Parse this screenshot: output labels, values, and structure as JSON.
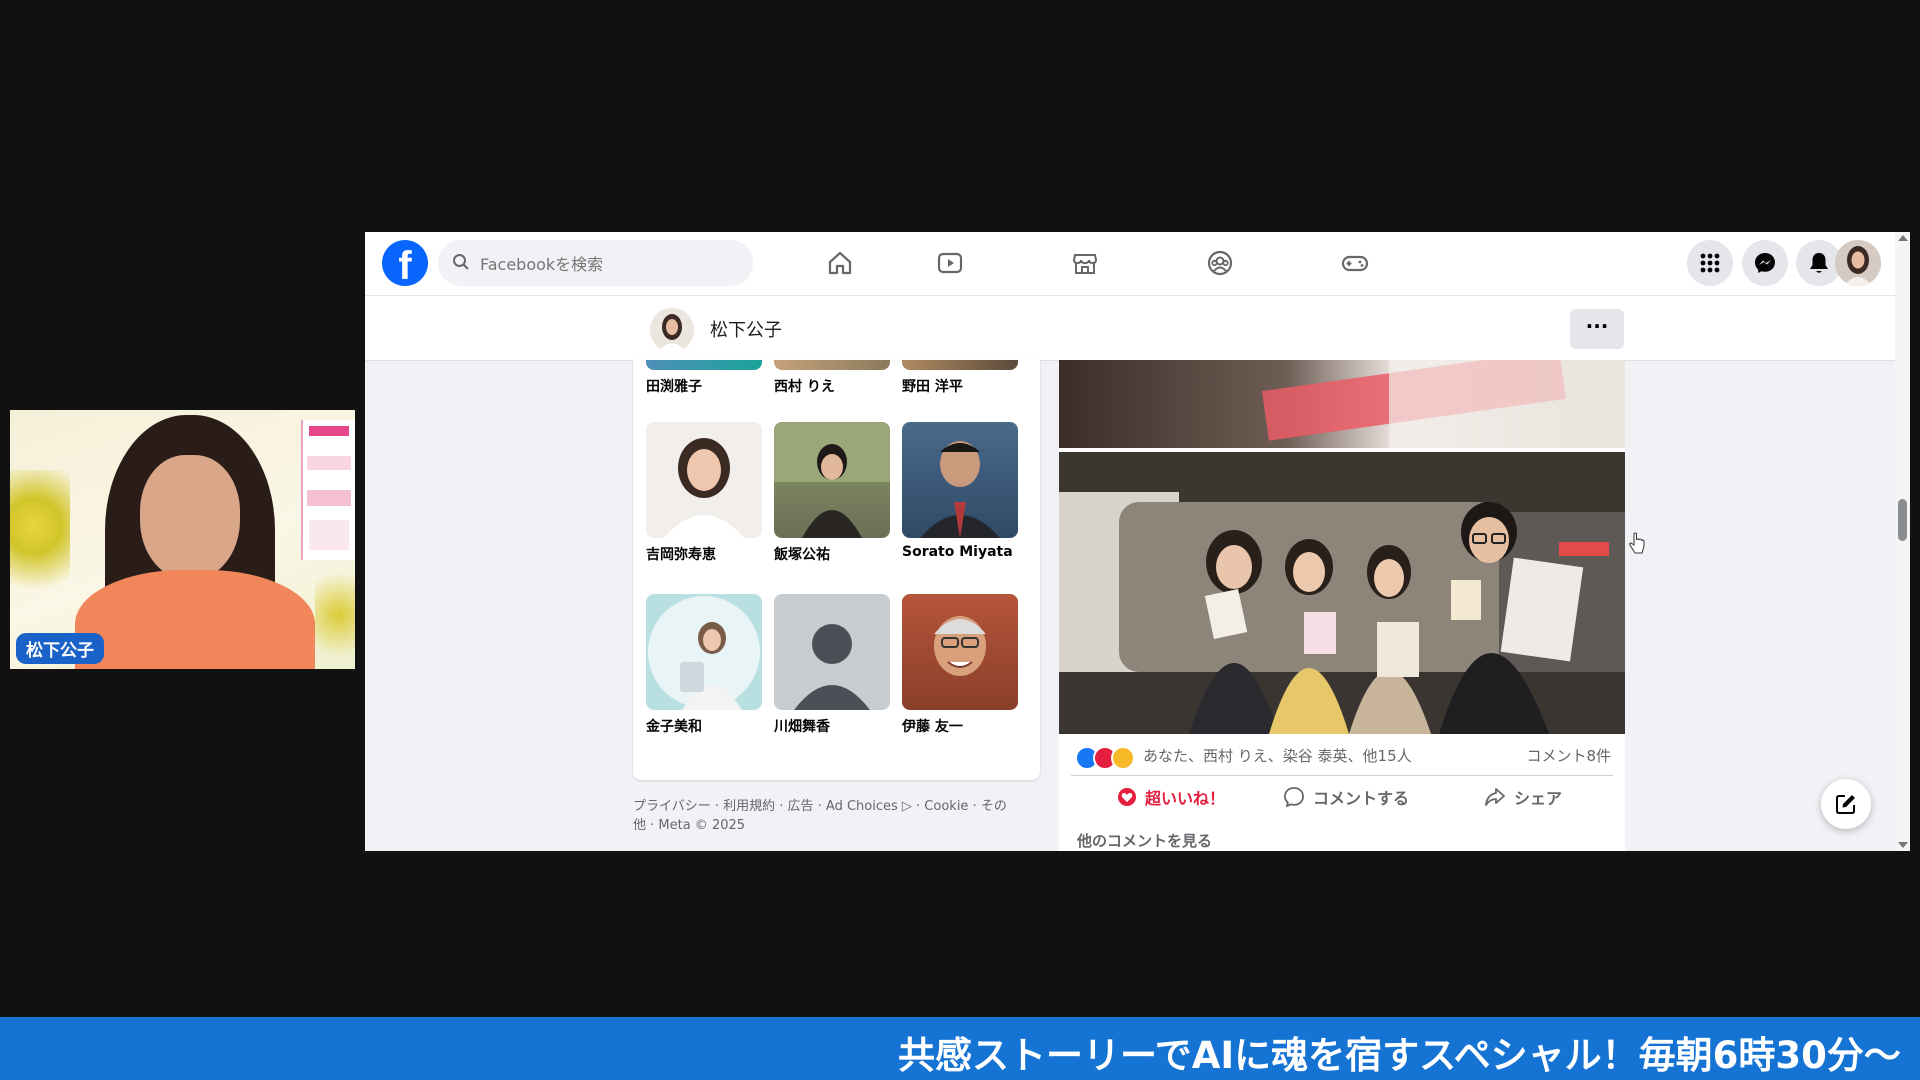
{
  "presenter": {
    "name": "松下公子"
  },
  "topbar": {
    "search_placeholder": "Facebookを検索",
    "nav_icons": [
      "home-icon",
      "video-icon",
      "marketplace-icon",
      "groups-icon",
      "gaming-icon"
    ],
    "right_icons": [
      "menu-grid-icon",
      "messenger-icon",
      "notifications-icon",
      "account-avatar"
    ]
  },
  "profile_bar": {
    "name": "松下公子",
    "more_label": "···"
  },
  "friends": {
    "top_row": [
      "田渕雅子",
      "西村 りえ",
      "野田 洋平"
    ],
    "rows": [
      [
        "吉岡弥寿恵",
        "飯塚公祐",
        "Sorato Miyata"
      ],
      [
        "金子美和",
        "川畑舞香",
        "伊藤 友一"
      ]
    ]
  },
  "footer": {
    "line1": "プライバシー · 利用規約 · 広告 · Ad Choices ▷ · Cookie · その",
    "line2": "他 · Meta © 2025"
  },
  "post": {
    "reaction_text": "あなた、西村 りえ、染谷 泰英、他15人",
    "comment_count": "コメント8件",
    "actions": {
      "love": "超いいね！",
      "comment": "コメントする",
      "share": "シェア"
    },
    "more_comments": "他のコメントを見る"
  },
  "ticker": {
    "text": "共感ストーリーでAIに魂を宿すスペシャル！毎朝6時30分〜"
  },
  "colors": {
    "fb_blue": "#0866ff",
    "love_red": "#e41e3f",
    "ticker_blue": "#1573d3"
  }
}
